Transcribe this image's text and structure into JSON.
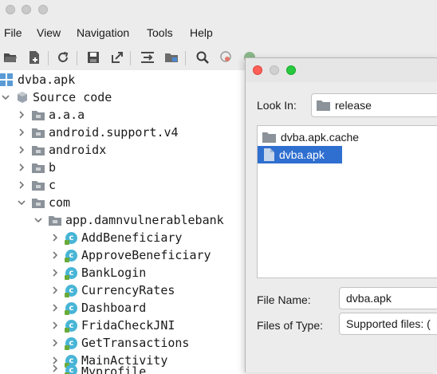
{
  "menubar": {
    "items": [
      "File",
      "View",
      "Navigation",
      "Tools",
      "Help"
    ]
  },
  "tree": {
    "root": "dvba.apk",
    "source_code": "Source code",
    "packages": [
      "a.a.a",
      "android.support.v4",
      "androidx",
      "b",
      "c",
      "com"
    ],
    "subpackage": "app.damnvulnerablebank",
    "classes": [
      "AddBeneficiary",
      "ApproveBeneficiary",
      "BankLogin",
      "CurrencyRates",
      "Dashboard",
      "FridaCheckJNI",
      "GetTransactions",
      "MainActivity",
      "Myprofile"
    ]
  },
  "dialog": {
    "look_in_label": "Look In:",
    "look_in_value": "release",
    "files": [
      {
        "name": "dvba.apk.cache",
        "type": "folder",
        "selected": false
      },
      {
        "name": "dvba.apk",
        "type": "file",
        "selected": true
      }
    ],
    "file_name_label": "File Name:",
    "file_name_value": "dvba.apk",
    "files_of_type_label": "Files of Type:",
    "files_of_type_value": "Supported files: (",
    "selection_color": "#2f6fd0"
  },
  "icons": {
    "folder": "folder-icon",
    "class": "class-icon",
    "apk": "apk-icon"
  }
}
